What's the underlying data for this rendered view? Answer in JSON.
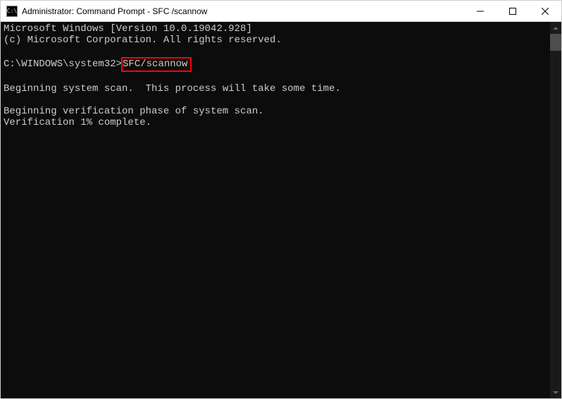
{
  "titlebar": {
    "icon_label": "cmd-icon",
    "icon_text": "C:\\",
    "title": "Administrator: Command Prompt - SFC /scannow"
  },
  "terminal": {
    "line1": "Microsoft Windows [Version 10.0.19042.928]",
    "line2": "(c) Microsoft Corporation. All rights reserved.",
    "blank1": "",
    "prompt_prefix": "C:\\WINDOWS\\system32>",
    "prompt_command": "SFC/scannow",
    "blank2": "",
    "line3": "Beginning system scan.  This process will take some time.",
    "blank3": "",
    "line4": "Beginning verification phase of system scan.",
    "line5": "Verification 1% complete."
  }
}
